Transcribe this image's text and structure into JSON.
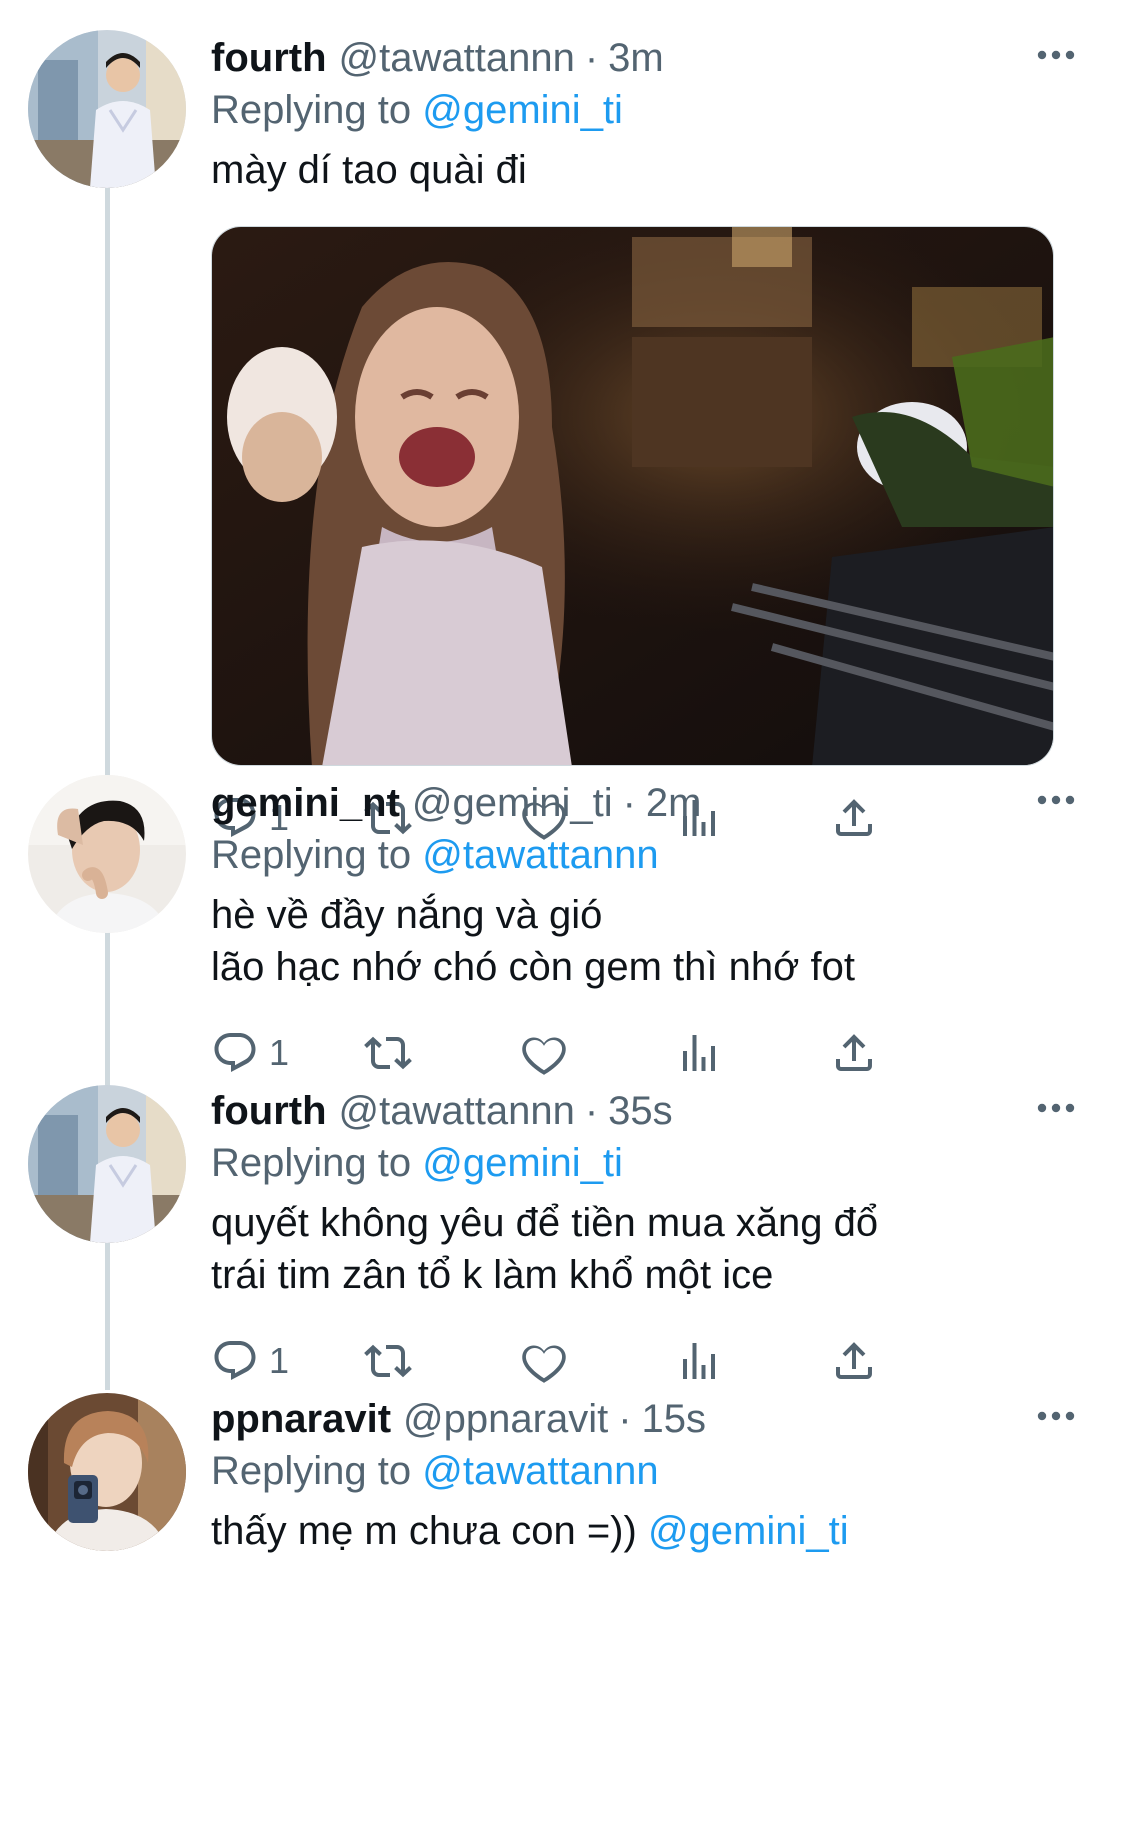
{
  "tweets": [
    {
      "name": "fourth",
      "handle": "@tawattannn",
      "time": "3m",
      "replying_prefix": "Replying to",
      "replying_to": "@gemini_ti",
      "text_lines": [
        "mày dí tao quài đi"
      ],
      "reply_count": "1",
      "has_media": true
    },
    {
      "name": "gemini_nt",
      "handle": "@gemini_ti",
      "time": "2m",
      "replying_prefix": "Replying to",
      "replying_to": "@tawattannn",
      "text_lines": [
        "hè về đầy nắng và gió",
        "lão hạc nhớ chó còn gem thì nhớ fot"
      ],
      "reply_count": "1"
    },
    {
      "name": "fourth",
      "handle": "@tawattannn",
      "time": "35s",
      "replying_prefix": "Replying to",
      "replying_to": "@gemini_ti",
      "text_lines": [
        "quyết không yêu để tiền mua xăng đổ",
        "trái tim zân tổ k làm khổ một ice"
      ],
      "reply_count": "1"
    },
    {
      "name": "ppnaravit",
      "handle": "@ppnaravit",
      "time": "15s",
      "replying_prefix": "Replying to",
      "replying_to": "@tawattannn",
      "text_main": "thấy mẹ m chưa con =)) ",
      "text_mention": "@gemini_ti"
    }
  ],
  "separator": "·",
  "icons": {
    "reply": "reply-icon",
    "retweet": "retweet-icon",
    "like": "heart-icon",
    "views": "analytics-icon",
    "share": "share-icon",
    "more": "more-icon"
  },
  "colors": {
    "accent": "#1d9bf0",
    "secondary_text": "#536471",
    "thread_line": "#cfd9de"
  }
}
